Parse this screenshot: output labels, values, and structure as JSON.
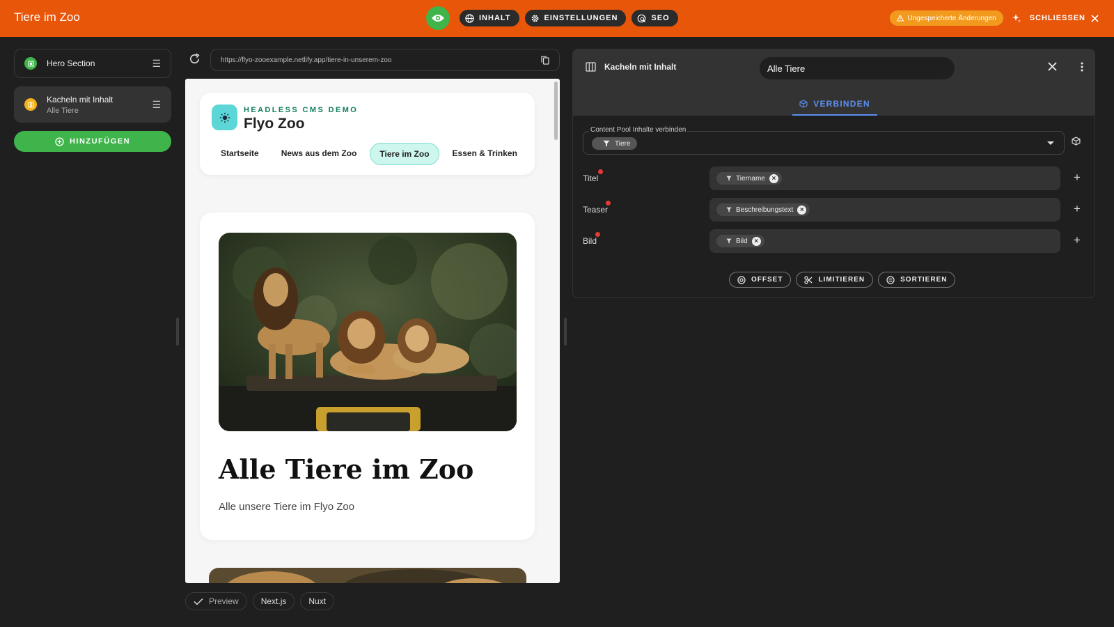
{
  "topbar": {
    "title": "Tiere im Zoo",
    "tabs": [
      {
        "label": "INHALT",
        "icon": "globe-icon"
      },
      {
        "label": "EINSTELLUNGEN",
        "icon": "gear-icon"
      },
      {
        "label": "SEO",
        "icon": "seo-icon"
      }
    ],
    "unsaved_label": "Ungespeicherte Änderungen",
    "close_label": "SCHLIESSEN",
    "accent_color": "#e8560a"
  },
  "sidebar": {
    "sections": [
      {
        "label": "Hero Section",
        "sublabel": "",
        "dot_color": "#3fb44a"
      },
      {
        "label": "Kacheln mit Inhalt",
        "sublabel": "Alle Tiere",
        "dot_color": "#f6b21b"
      }
    ],
    "add_label": "HINZUFÜGEN"
  },
  "preview": {
    "url": "https://flyo-zooexample.netlify.app/tiere-in-unserem-zoo",
    "site": {
      "tagline": "HEADLESS CMS DEMO",
      "name": "Flyo Zoo",
      "nav": [
        "Startseite",
        "News aus dem Zoo",
        "Tiere im Zoo",
        "Essen & Trinken"
      ],
      "active_nav": "Tiere im Zoo"
    },
    "hero": {
      "title": "Alle Tiere im Zoo",
      "subtitle": "Alle unsere Tiere im Flyo Zoo"
    },
    "frameworks": [
      "Preview",
      "Next.js",
      "Nuxt"
    ]
  },
  "panel": {
    "title": "Kacheln mit Inhalt",
    "name_value": "Alle Tiere",
    "tab": "VERBINDEN",
    "pool": {
      "legend": "Content Pool Inhalte verbinden",
      "value": "Tiere"
    },
    "fields": [
      {
        "label": "Titel",
        "value": "Tiername"
      },
      {
        "label": "Teaser",
        "value": "Beschreibungstext"
      },
      {
        "label": "Bild",
        "value": "Bild"
      }
    ],
    "actions": [
      {
        "label": "OFFSET",
        "icon": "offset-icon"
      },
      {
        "label": "LIMITIEREN",
        "icon": "scissors-icon"
      },
      {
        "label": "SORTIEREN",
        "icon": "sort-icon"
      }
    ]
  }
}
